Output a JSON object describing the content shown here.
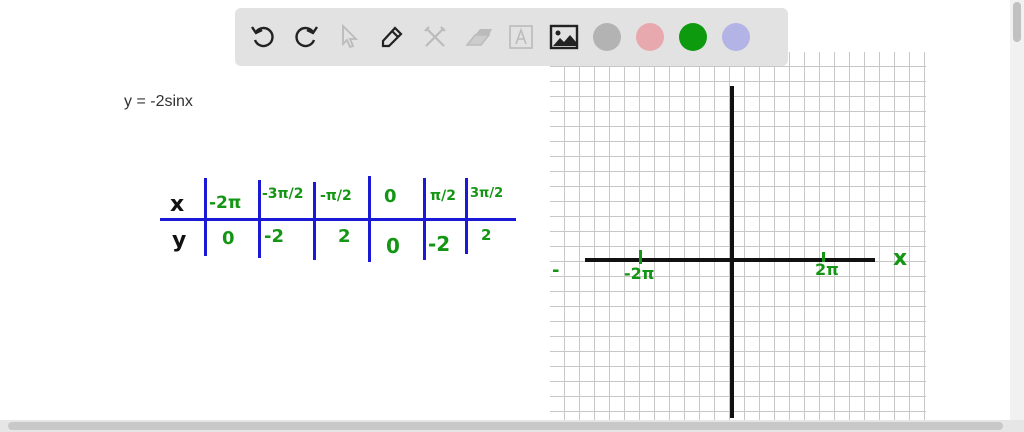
{
  "toolbar": {
    "tools": [
      "undo",
      "redo",
      "select",
      "pen",
      "tools",
      "eraser",
      "text",
      "image"
    ],
    "colors": [
      "#b3b3b3",
      "#e8a9ae",
      "#0e9a0e",
      "#b3b3e6"
    ]
  },
  "equation": "y = -2sinx",
  "table": {
    "x_label": "x",
    "y_label": "y",
    "x_values": [
      "-2π",
      "-3π/2",
      "-π/2",
      "0",
      "π/2",
      "3π/2"
    ],
    "y_values": [
      "0",
      "-2",
      "2",
      "0",
      "-2",
      "2"
    ]
  },
  "graph": {
    "x_axis_label": "x",
    "tick_neg": "-2π",
    "tick_pos": "2π",
    "left_mark": "-"
  }
}
